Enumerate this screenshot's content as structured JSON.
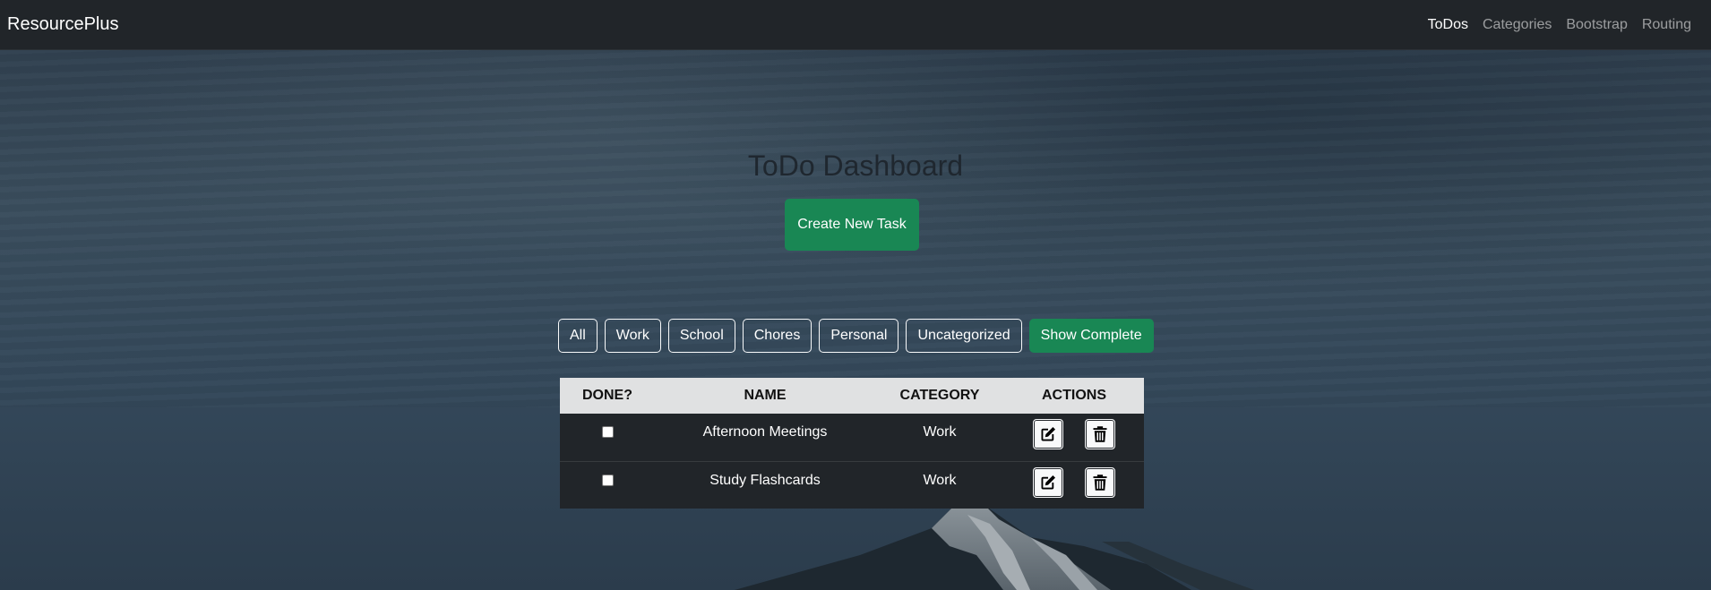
{
  "navbar": {
    "brand": "ResourcePlus",
    "links": [
      {
        "label": "ToDos",
        "active": true
      },
      {
        "label": "Categories",
        "active": false
      },
      {
        "label": "Bootstrap",
        "active": false
      },
      {
        "label": "Routing",
        "active": false
      }
    ]
  },
  "main": {
    "title": "ToDo Dashboard",
    "create_button": "Create New Task"
  },
  "filters": [
    "All",
    "Work",
    "School",
    "Chores",
    "Personal",
    "Uncategorized",
    "Show Complete"
  ],
  "table": {
    "headers": [
      "Done?",
      "Name",
      "Category",
      "Actions"
    ],
    "rows": [
      {
        "done": false,
        "name": "Afternoon Meetings",
        "category": "Work"
      },
      {
        "done": false,
        "name": "Study Flashcards",
        "category": "Work"
      }
    ]
  },
  "icons": {
    "edit": "pencil-square-icon",
    "delete": "trash-icon"
  },
  "colors": {
    "navbar": "#212529",
    "success": "#198754",
    "table_header": "#e0e1e2",
    "table_body": "#212529"
  }
}
